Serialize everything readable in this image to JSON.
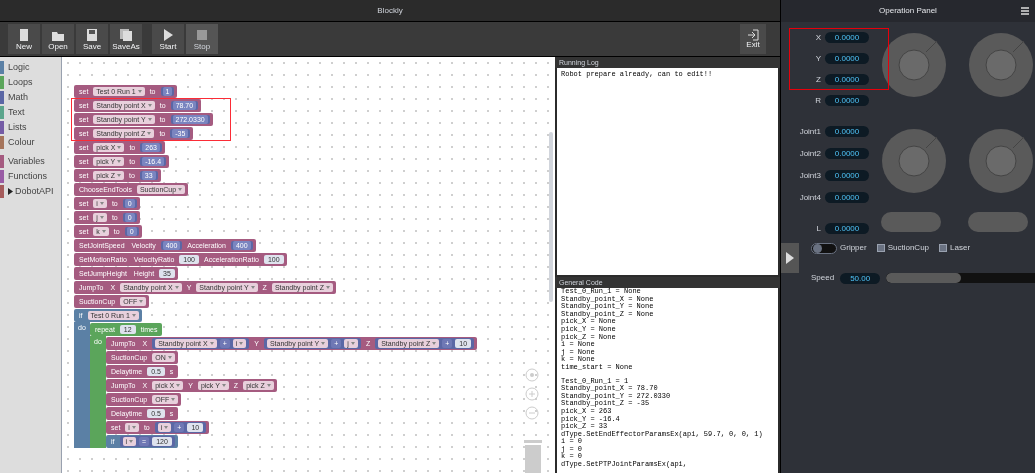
{
  "window": {
    "title": "Blockly"
  },
  "toolbar": [
    {
      "label": "New",
      "disabled": false
    },
    {
      "label": "Open",
      "disabled": false
    },
    {
      "label": "Save",
      "disabled": false
    },
    {
      "label": "SaveAs",
      "disabled": false
    },
    {
      "label": "Start",
      "disabled": false
    },
    {
      "label": "Stop",
      "disabled": true
    }
  ],
  "exit_button": {
    "label": "Exit"
  },
  "categories": [
    {
      "label": "Logic",
      "color": "#5b80a5",
      "kind": "category"
    },
    {
      "label": "Loops",
      "color": "#5ba55b",
      "kind": "category"
    },
    {
      "label": "Math",
      "color": "#5b67a5",
      "kind": "category"
    },
    {
      "label": "Text",
      "color": "#5ba58c",
      "kind": "category"
    },
    {
      "label": "Lists",
      "color": "#745ba5",
      "kind": "category"
    },
    {
      "label": "Colour",
      "color": "#a5745b",
      "kind": "category"
    },
    {
      "label": "Variables",
      "color": "#a55b80",
      "kind": "category"
    },
    {
      "label": "Functions",
      "color": "#995ba5",
      "kind": "category"
    },
    {
      "label": "DobotAPI",
      "color": "#a55b5b",
      "kind": "folder"
    }
  ],
  "blocks": [
    {
      "kind": "var",
      "parts": [
        {
          "kind": "label",
          "text": "set"
        },
        {
          "kind": "dropdown",
          "text": "Test 0 Run 1"
        },
        {
          "kind": "label",
          "text": "to"
        },
        {
          "kind": "num",
          "text": "1"
        }
      ]
    },
    {
      "kind": "var",
      "parts": [
        {
          "kind": "label",
          "text": "set"
        },
        {
          "kind": "dropdown",
          "text": "Standby point X"
        },
        {
          "kind": "label",
          "text": "to"
        },
        {
          "kind": "num",
          "text": "78.70"
        }
      ]
    },
    {
      "kind": "var",
      "parts": [
        {
          "kind": "label",
          "text": "set"
        },
        {
          "kind": "dropdown",
          "text": "Standby point Y"
        },
        {
          "kind": "label",
          "text": "to"
        },
        {
          "kind": "num",
          "text": "272.0330"
        }
      ]
    },
    {
      "kind": "var",
      "parts": [
        {
          "kind": "label",
          "text": "set"
        },
        {
          "kind": "dropdown",
          "text": "Standby point Z"
        },
        {
          "kind": "label",
          "text": "to"
        },
        {
          "kind": "num",
          "text": "-35"
        }
      ]
    },
    {
      "kind": "var",
      "parts": [
        {
          "kind": "label",
          "text": "set"
        },
        {
          "kind": "dropdown",
          "text": "pick X"
        },
        {
          "kind": "label",
          "text": "to"
        },
        {
          "kind": "num",
          "text": "263"
        }
      ]
    },
    {
      "kind": "var",
      "parts": [
        {
          "kind": "label",
          "text": "set"
        },
        {
          "kind": "dropdown",
          "text": "pick Y"
        },
        {
          "kind": "label",
          "text": "to"
        },
        {
          "kind": "num",
          "text": "-16.4"
        }
      ]
    },
    {
      "kind": "var",
      "parts": [
        {
          "kind": "label",
          "text": "set"
        },
        {
          "kind": "dropdown",
          "text": "pick Z"
        },
        {
          "kind": "label",
          "text": "to"
        },
        {
          "kind": "num",
          "text": "33"
        }
      ]
    },
    {
      "kind": "var",
      "parts": [
        {
          "kind": "label",
          "text": "ChooseEndTools"
        },
        {
          "kind": "dropdown",
          "text": "SuctionCup"
        }
      ]
    },
    {
      "kind": "var",
      "parts": [
        {
          "kind": "label",
          "text": "set"
        },
        {
          "kind": "dropdown",
          "text": "i"
        },
        {
          "kind": "label",
          "text": "to"
        },
        {
          "kind": "num",
          "text": "0"
        }
      ]
    },
    {
      "kind": "var",
      "parts": [
        {
          "kind": "label",
          "text": "set"
        },
        {
          "kind": "dropdown",
          "text": "j"
        },
        {
          "kind": "label",
          "text": "to"
        },
        {
          "kind": "num",
          "text": "0"
        }
      ]
    },
    {
      "kind": "var",
      "parts": [
        {
          "kind": "label",
          "text": "set"
        },
        {
          "kind": "dropdown",
          "text": "k"
        },
        {
          "kind": "label",
          "text": "to"
        },
        {
          "kind": "num",
          "text": "0"
        }
      ]
    },
    {
      "kind": "var",
      "parts": [
        {
          "kind": "label",
          "text": "SetJointSpeed"
        },
        {
          "kind": "label",
          "text": "Velocity"
        },
        {
          "kind": "num",
          "text": "400"
        },
        {
          "kind": "label",
          "text": "Acceleration"
        },
        {
          "kind": "num",
          "text": "400"
        }
      ]
    },
    {
      "kind": "var",
      "parts": [
        {
          "kind": "label",
          "text": "SetMotionRatio"
        },
        {
          "kind": "label",
          "text": "VelocityRatio"
        },
        {
          "kind": "input",
          "text": "100"
        },
        {
          "kind": "label",
          "text": "AccelerationRatio"
        },
        {
          "kind": "input",
          "text": "100"
        }
      ]
    },
    {
      "kind": "var",
      "parts": [
        {
          "kind": "label",
          "text": "SetJumpHeight"
        },
        {
          "kind": "label",
          "text": "Height"
        },
        {
          "kind": "input",
          "text": "35"
        }
      ]
    },
    {
      "kind": "var",
      "parts": [
        {
          "kind": "label",
          "text": "JumpTo"
        },
        {
          "kind": "label",
          "text": "X"
        },
        {
          "kind": "dropdown",
          "text": "Standby point X"
        },
        {
          "kind": "label",
          "text": "Y"
        },
        {
          "kind": "dropdown",
          "text": "Standby point Y"
        },
        {
          "kind": "label",
          "text": "Z"
        },
        {
          "kind": "dropdown",
          "text": "Standby point Z"
        }
      ]
    },
    {
      "kind": "var",
      "parts": [
        {
          "kind": "label",
          "text": "SuctionCup"
        },
        {
          "kind": "dropdown",
          "text": "OFF"
        }
      ]
    },
    {
      "kind": "logic",
      "parts": [
        {
          "kind": "label",
          "text": "if"
        },
        {
          "kind": "dropdown",
          "text": "Test 0 Run 1"
        }
      ],
      "do": "do",
      "children": [
        {
          "kind": "loop",
          "parts": [
            {
              "kind": "label",
              "text": "repeat"
            },
            {
              "kind": "input",
              "text": "12"
            },
            {
              "kind": "label",
              "text": "times"
            }
          ],
          "do": "do",
          "children": [
            {
              "kind": "var",
              "parts": [
                {
                  "kind": "label",
                  "text": "JumpTo"
                },
                {
                  "kind": "label",
                  "text": "X"
                },
                {
                  "kind": "expr",
                  "parts": [
                    {
                      "kind": "dropdown",
                      "text": "Standby point X"
                    },
                    {
                      "kind": "op",
                      "text": "+"
                    },
                    {
                      "kind": "dropdown",
                      "text": "i"
                    }
                  ]
                },
                {
                  "kind": "label",
                  "text": "Y"
                },
                {
                  "kind": "expr",
                  "parts": [
                    {
                      "kind": "dropdown",
                      "text": "Standby point Y"
                    },
                    {
                      "kind": "op",
                      "text": "+"
                    },
                    {
                      "kind": "dropdown",
                      "text": "j"
                    }
                  ]
                },
                {
                  "kind": "label",
                  "text": "Z"
                },
                {
                  "kind": "expr",
                  "parts": [
                    {
                      "kind": "dropdown",
                      "text": "Standby point Z"
                    },
                    {
                      "kind": "op",
                      "text": "+"
                    },
                    {
                      "kind": "input",
                      "text": "10"
                    }
                  ]
                }
              ]
            },
            {
              "kind": "var",
              "parts": [
                {
                  "kind": "label",
                  "text": "SuctionCup"
                },
                {
                  "kind": "dropdown",
                  "text": "ON"
                }
              ]
            },
            {
              "kind": "var",
              "parts": [
                {
                  "kind": "label",
                  "text": "Delaytime"
                },
                {
                  "kind": "input",
                  "text": "0.5"
                },
                {
                  "kind": "label",
                  "text": "s"
                }
              ]
            },
            {
              "kind": "var",
              "parts": [
                {
                  "kind": "label",
                  "text": "JumpTo"
                },
                {
                  "kind": "label",
                  "text": "X"
                },
                {
                  "kind": "dropdown",
                  "text": "pick X"
                },
                {
                  "kind": "label",
                  "text": "Y"
                },
                {
                  "kind": "dropdown",
                  "text": "pick Y"
                },
                {
                  "kind": "label",
                  "text": "Z"
                },
                {
                  "kind": "dropdown",
                  "text": "pick Z"
                }
              ]
            },
            {
              "kind": "var",
              "parts": [
                {
                  "kind": "label",
                  "text": "SuctionCup"
                },
                {
                  "kind": "dropdown",
                  "text": "OFF"
                }
              ]
            },
            {
              "kind": "var",
              "parts": [
                {
                  "kind": "label",
                  "text": "Delaytime"
                },
                {
                  "kind": "input",
                  "text": "0.5"
                },
                {
                  "kind": "label",
                  "text": "s"
                }
              ]
            },
            {
              "kind": "var",
              "parts": [
                {
                  "kind": "label",
                  "text": "set"
                },
                {
                  "kind": "dropdown",
                  "text": "i"
                },
                {
                  "kind": "label",
                  "text": "to"
                },
                {
                  "kind": "expr",
                  "parts": [
                    {
                      "kind": "dropdown",
                      "text": "i"
                    },
                    {
                      "kind": "op",
                      "text": "+"
                    },
                    {
                      "kind": "input",
                      "text": "10"
                    }
                  ]
                }
              ]
            },
            {
              "kind": "logic",
              "parts": [
                {
                  "kind": "label",
                  "text": "if"
                },
                {
                  "kind": "expr",
                  "parts": [
                    {
                      "kind": "dropdown",
                      "text": "i"
                    },
                    {
                      "kind": "op",
                      "text": "="
                    },
                    {
                      "kind": "input",
                      "text": "120"
                    }
                  ]
                }
              ]
            }
          ]
        }
      ]
    }
  ],
  "running_log": {
    "title": "Running Log",
    "lines": [
      "Robot prepare already, can to edit!!"
    ]
  },
  "generated_code": {
    "title": "General Code",
    "sections": [
      [
        "Test_0_Run_1 = None",
        "Standby_point_X = None",
        "Standby_point_Y = None",
        "Standby_point_Z = None",
        "pick_X = None",
        "pick_Y = None",
        "pick_Z = None",
        "i = None",
        "j = None",
        "k = None",
        "time_start = None"
      ],
      [
        "Test_0_Run_1 = 1",
        "Standby_point_X = 78.70",
        "Standby_point_Y = 272.0330",
        "Standby_point_Z = -35",
        "pick_X = 263",
        "pick_Y = -16.4",
        "pick_Z = 33",
        "dType.SetEndEffectorParamsEx(api, 59.7, 0, 0, 1)",
        "i = 0",
        "j = 0",
        "k = 0",
        "dType.SetPTPJointParamsEx(api,"
      ]
    ]
  },
  "operation_panel": {
    "title": "Operation Panel",
    "coordinates": [
      {
        "label": "X",
        "value": "0.0000"
      },
      {
        "label": "Y",
        "value": "0.0000"
      },
      {
        "label": "Z",
        "value": "0.0000"
      },
      {
        "label": "R",
        "value": "0.0000"
      }
    ],
    "joints": [
      {
        "label": "Joint1",
        "value": "0.0000"
      },
      {
        "label": "Joint2",
        "value": "0.0000"
      },
      {
        "label": "Joint3",
        "value": "0.0000"
      },
      {
        "label": "Joint4",
        "value": "0.0000"
      }
    ],
    "l": {
      "label": "L",
      "value": "0.0000"
    },
    "tools": [
      {
        "label": "Gripper",
        "kind": "toggle",
        "checked": false
      },
      {
        "label": "SuctionCup",
        "kind": "checkbox",
        "checked": false
      },
      {
        "label": "Laser",
        "kind": "checkbox",
        "checked": false
      }
    ],
    "speed": {
      "label": "Speed",
      "value": "50.00",
      "level": 0.5
    }
  }
}
